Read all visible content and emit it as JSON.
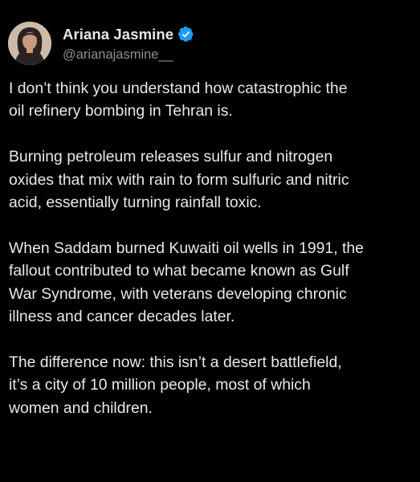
{
  "author": {
    "display_name": "Ariana Jasmine",
    "handle": "@arianajasmine__",
    "verified": true,
    "avatar_icon": "profile-photo",
    "verified_icon": "verified-badge-icon",
    "verified_color": "#1d9bf0"
  },
  "tweet": {
    "paragraphs": [
      "I don’t think you understand how catastrophic the\noil refinery bombing in Tehran is.",
      "Burning petroleum releases sulfur and nitrogen\noxides that mix with rain to form sulfuric and nitric\nacid, essentially turning rainfall toxic.",
      "When Saddam burned Kuwaiti oil wells in 1991, the\nfallout contributed to what became known as Gulf\nWar Syndrome, with veterans developing chronic\nillness and cancer decades later.",
      "The difference now: this isn’t a desert battlefield,\nit’s a city of 10 million people, most of which\nwomen and children."
    ]
  },
  "colors": {
    "background": "#000000",
    "text": "#e7e9ea",
    "secondary_text": "#8b8f95"
  }
}
